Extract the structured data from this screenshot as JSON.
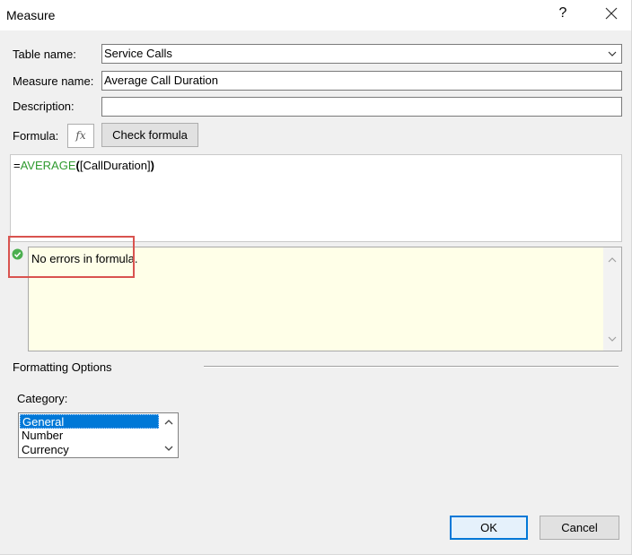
{
  "window": {
    "title": "Measure",
    "help_label": "?",
    "close_icon": "close-icon"
  },
  "table_name": {
    "label": "Table name:",
    "value": "Service Calls"
  },
  "measure_name": {
    "label": "Measure name:",
    "value": "Average Call Duration"
  },
  "description": {
    "label": "Description:",
    "value": ""
  },
  "formula": {
    "label": "Formula:",
    "fx_label": "fx",
    "check_button": "Check formula",
    "prefix": "=",
    "function": "AVERAGE",
    "open": "(",
    "argument": "[CallDuration]",
    "close": ")"
  },
  "status": {
    "message": "No errors in formula.",
    "icon": "check-circle-icon",
    "color": "#4caf50"
  },
  "formatting": {
    "heading": "Formatting Options",
    "category_label": "Category:",
    "categories": [
      "General",
      "Number",
      "Currency"
    ],
    "selected": "General"
  },
  "buttons": {
    "ok": "OK",
    "cancel": "Cancel"
  },
  "colors": {
    "accent": "#0078d7",
    "highlight": "#d9534f",
    "formula_function": "#2f9a2f",
    "message_bg": "#ffffe8"
  }
}
